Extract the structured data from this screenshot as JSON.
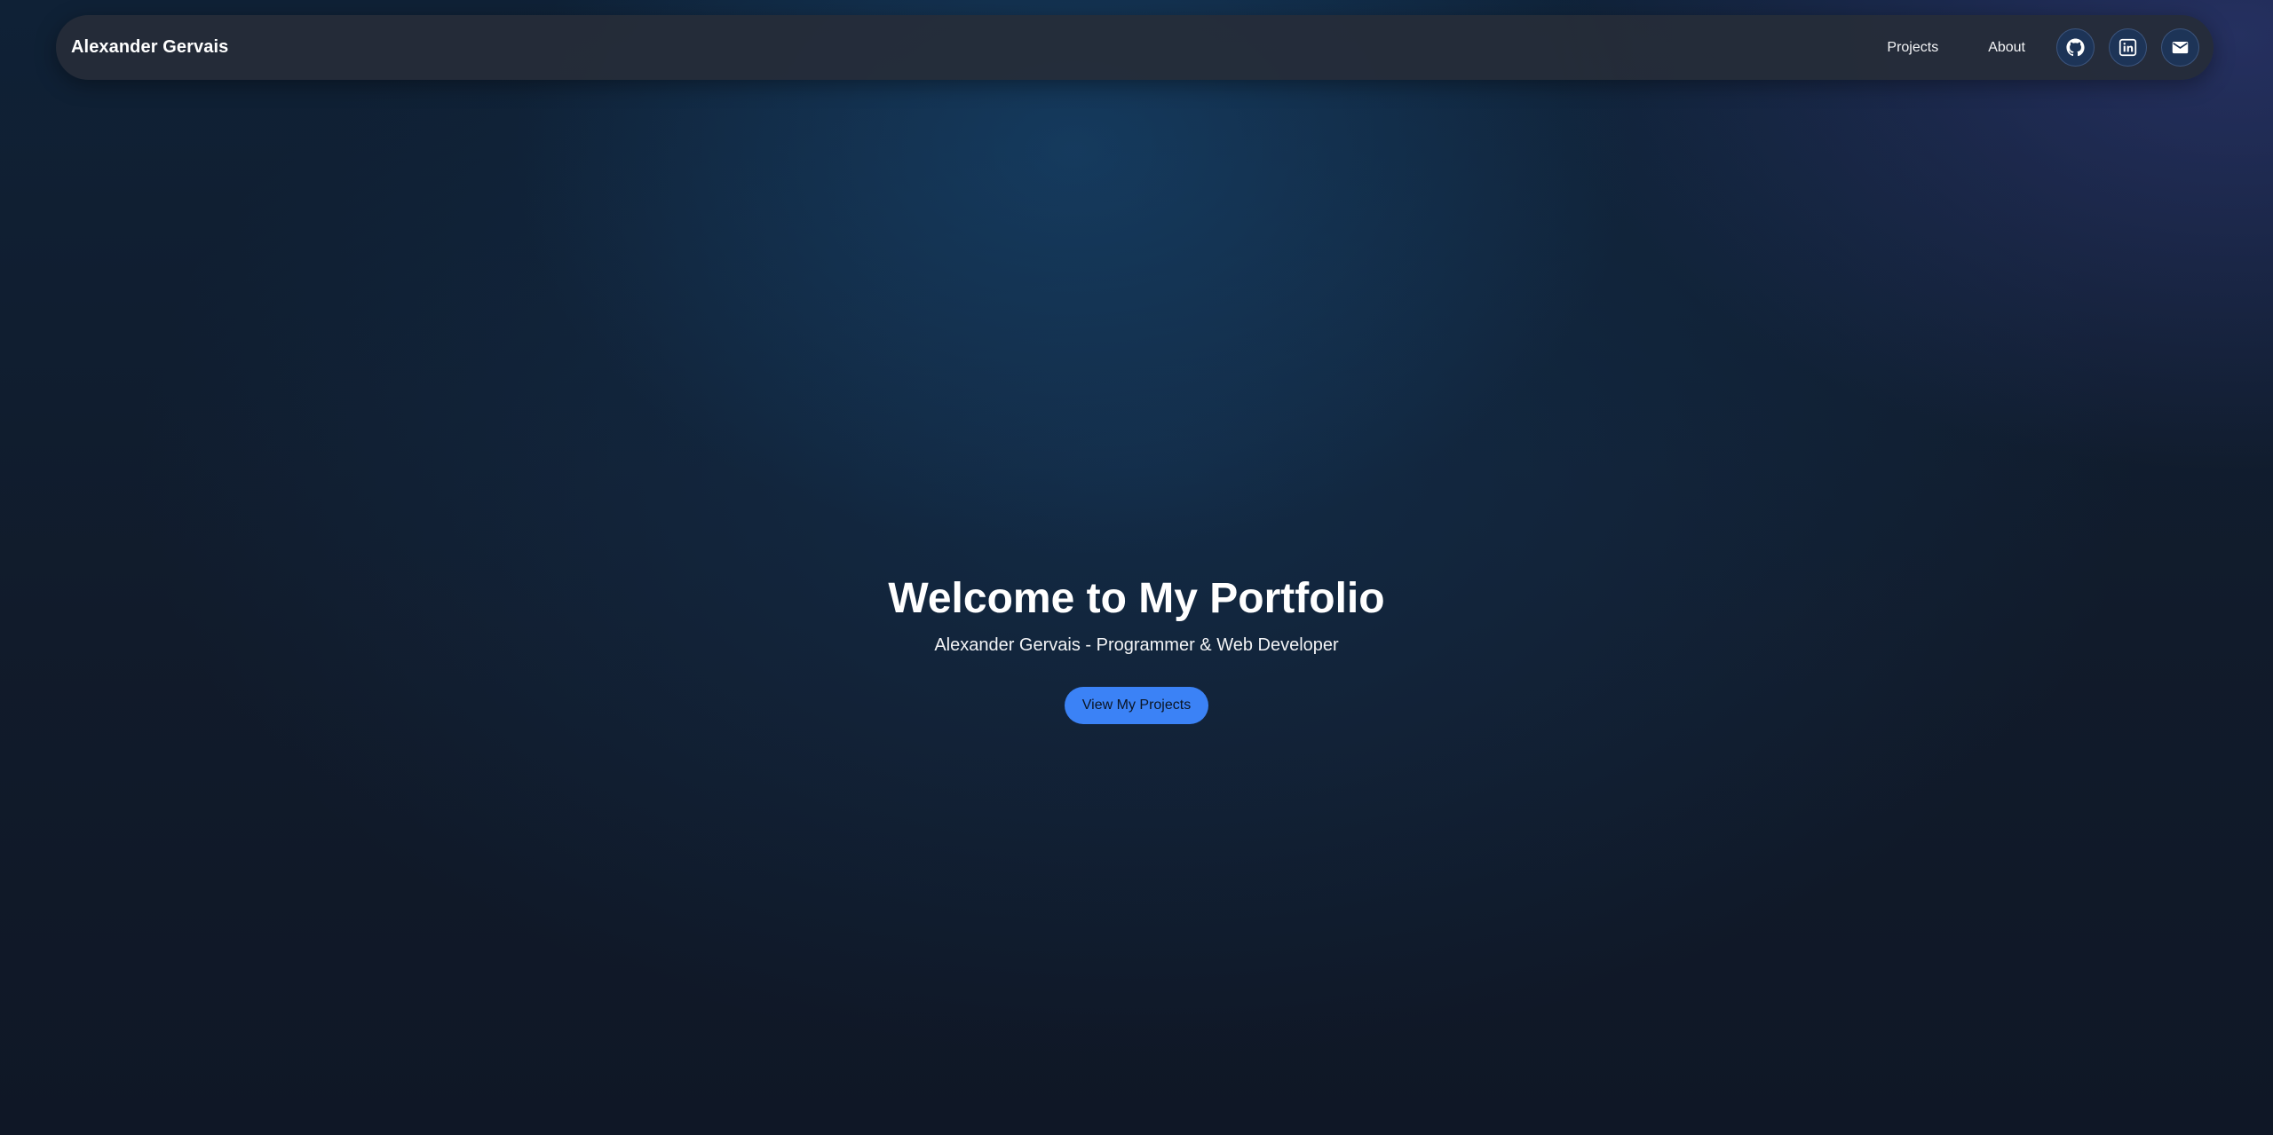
{
  "header": {
    "brand": "Alexander Gervais",
    "nav": [
      {
        "label": "Projects"
      },
      {
        "label": "About"
      }
    ],
    "social": [
      {
        "icon": "github-icon"
      },
      {
        "icon": "linkedin-icon"
      },
      {
        "icon": "mail-icon"
      }
    ]
  },
  "hero": {
    "title": "Welcome to My Portfolio",
    "subtitle": "Alexander Gervais - Programmer & Web Developer",
    "cta_label": "View My Projects"
  },
  "colors": {
    "accent": "#3b82f6",
    "navbar_bg": "#262c38",
    "icon_button_bg": "#1d3457",
    "page_bg": "#111b2b"
  }
}
